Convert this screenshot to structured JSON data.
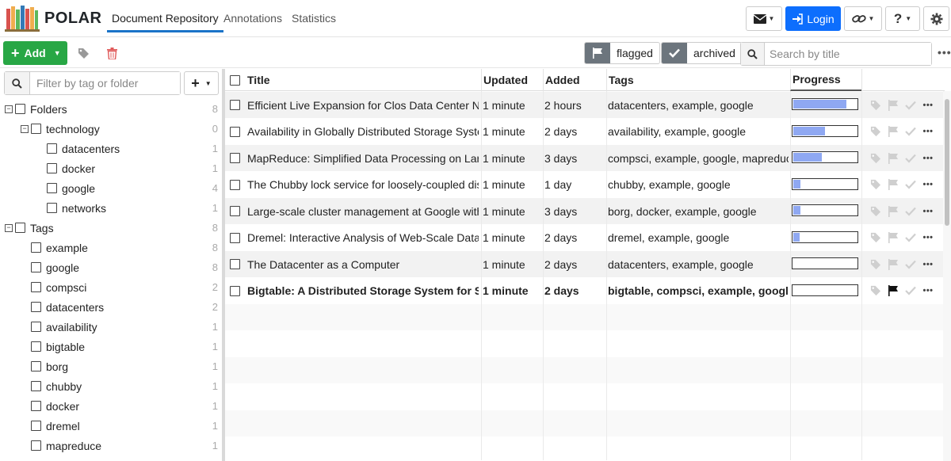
{
  "app": {
    "brand": "POLAR",
    "nav": [
      {
        "label": "Document Repository",
        "active": true
      },
      {
        "label": "Annotations",
        "active": false
      },
      {
        "label": "Statistics",
        "active": false
      }
    ],
    "login_label": "Login"
  },
  "toolbar": {
    "add_label": "Add",
    "flagged_label": "flagged",
    "archived_label": "archived",
    "search_placeholder": "Search by title"
  },
  "sidebar": {
    "filter_placeholder": "Filter by tag or folder",
    "folders_label": "Folders",
    "folders_count": "8",
    "technology": {
      "label": "technology",
      "count": "0"
    },
    "folder_children": [
      {
        "label": "datacenters",
        "count": "1"
      },
      {
        "label": "docker",
        "count": "1"
      },
      {
        "label": "google",
        "count": "4"
      },
      {
        "label": "networks",
        "count": "1"
      }
    ],
    "tags_label": "Tags",
    "tags_count": "8",
    "tags": [
      {
        "label": "example",
        "count": "8"
      },
      {
        "label": "google",
        "count": "8"
      },
      {
        "label": "compsci",
        "count": "2"
      },
      {
        "label": "datacenters",
        "count": "2"
      },
      {
        "label": "availability",
        "count": "1"
      },
      {
        "label": "bigtable",
        "count": "1"
      },
      {
        "label": "borg",
        "count": "1"
      },
      {
        "label": "chubby",
        "count": "1"
      },
      {
        "label": "docker",
        "count": "1"
      },
      {
        "label": "dremel",
        "count": "1"
      },
      {
        "label": "mapreduce",
        "count": "1"
      }
    ]
  },
  "table": {
    "headers": {
      "title": "Title",
      "updated": "Updated",
      "added": "Added",
      "tags": "Tags",
      "progress": "Progress"
    },
    "rows": [
      {
        "title": "Efficient Live Expansion for Clos Data Center Networks",
        "updated": "1 minute",
        "added": "2 hours",
        "tags": "datacenters, example, google",
        "progress": 0.84,
        "flagged": false,
        "bold": false
      },
      {
        "title": "Availability in Globally Distributed Storage Systems",
        "updated": "1 minute",
        "added": "2 days",
        "tags": "availability, example, google",
        "progress": 0.5,
        "flagged": false,
        "bold": false
      },
      {
        "title": "MapReduce: Simplified Data Processing on Large Clusters",
        "updated": "1 minute",
        "added": "3 days",
        "tags": "compsci, example, google, mapreduce",
        "progress": 0.45,
        "flagged": false,
        "bold": false
      },
      {
        "title": "The Chubby lock service for loosely-coupled distributed systems",
        "updated": "1 minute",
        "added": "1 day",
        "tags": "chubby, example, google",
        "progress": 0.11,
        "flagged": false,
        "bold": false
      },
      {
        "title": "Large-scale cluster management at Google with Borg",
        "updated": "1 minute",
        "added": "3 days",
        "tags": "borg, docker, example, google",
        "progress": 0.11,
        "flagged": false,
        "bold": false
      },
      {
        "title": "Dremel: Interactive Analysis of Web-Scale Datasets",
        "updated": "1 minute",
        "added": "2 days",
        "tags": "dremel, example, google",
        "progress": 0.1,
        "flagged": false,
        "bold": false
      },
      {
        "title": "The Datacenter as a Computer",
        "updated": "1 minute",
        "added": "2 days",
        "tags": "datacenters, example, google",
        "progress": 0.0,
        "flagged": false,
        "bold": false
      },
      {
        "title": "Bigtable: A Distributed Storage System for Structured Data",
        "updated": "1 minute",
        "added": "2 days",
        "tags": "bigtable, compsci, example, google",
        "progress": 0.0,
        "flagged": true,
        "bold": true
      }
    ]
  },
  "colors": {
    "accent": "#1a73c8",
    "add_green": "#28a745",
    "login_blue": "#0d6efd",
    "progress_fill": "#8fa8f2",
    "delete_red": "#e05a5a",
    "muted_icon": "#cfcfcf"
  },
  "icons": [
    "logo-books-icon",
    "envelope-icon",
    "login-icon",
    "link-icon",
    "help-icon",
    "gear-icon",
    "tag-icon",
    "trash-icon",
    "flag-icon",
    "check-icon",
    "search-icon",
    "more-icon"
  ]
}
